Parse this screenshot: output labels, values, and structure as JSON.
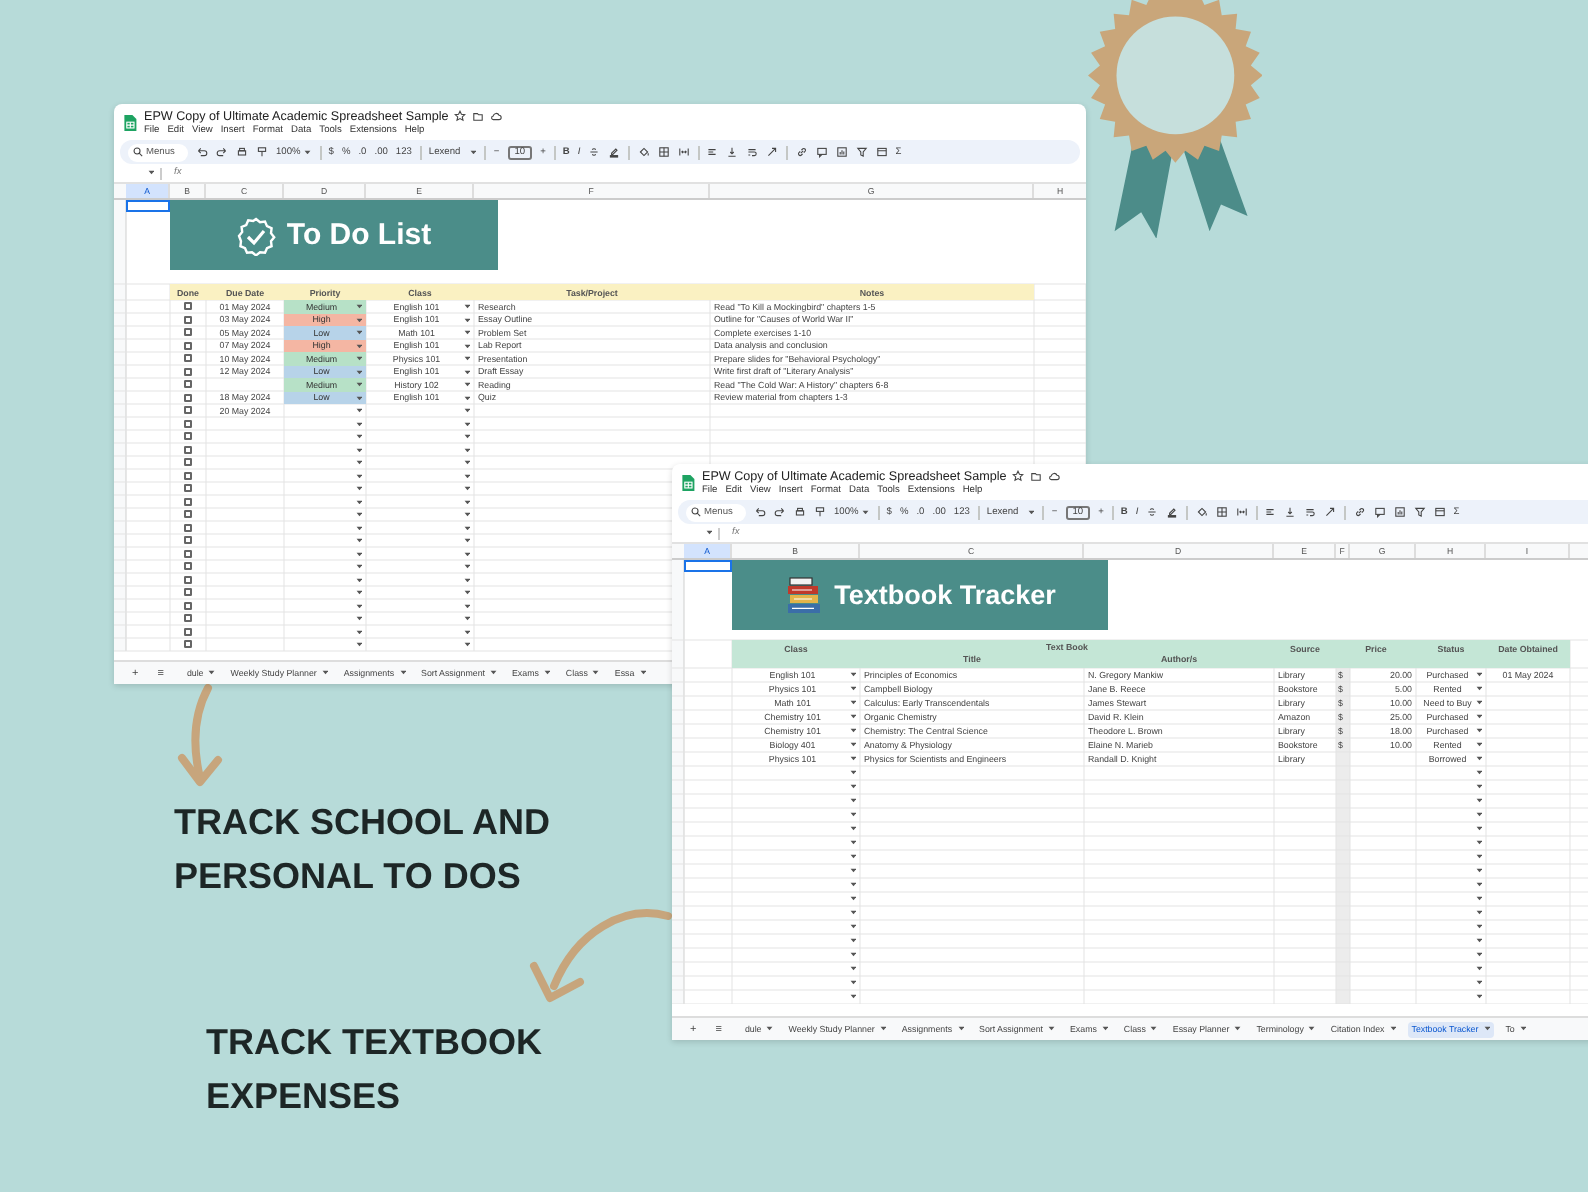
{
  "windows": [
    {
      "kind": "todo",
      "title": "EPW Copy of Ultimate Academic Spreadsheet Sample",
      "menu": [
        "File",
        "Edit",
        "View",
        "Insert",
        "Format",
        "Data",
        "Tools",
        "Extensions",
        "Help"
      ],
      "toolbar": {
        "search_placeholder": "Menus",
        "zoom": "100%",
        "currency": "$",
        "percent": "%",
        "decrease_decimal": ".0",
        "increase_decimal": ".00",
        "number_format": "123",
        "font": "Lexend",
        "decrease_size": "−",
        "font_size": "10",
        "increase_size": "+",
        "bold": "B",
        "italic": "I",
        "functions": "Σ"
      },
      "formula_label": "fx",
      "columns": [
        "A",
        "B",
        "C",
        "D",
        "E",
        "F",
        "G",
        "H"
      ],
      "banner": {
        "title": "To Do List"
      },
      "table": {
        "columns": [
          "Done",
          "Due Date",
          "Priority",
          "Class",
          "Task/Project",
          "Notes"
        ],
        "rows": [
          {
            "done": false,
            "due": "01 May 2024",
            "priority": {
              "label": "Medium",
              "color": "#b7e1c7"
            },
            "class": "English 101",
            "task": "Research",
            "notes": "Read \"To Kill a Mockingbird\" chapters 1-5"
          },
          {
            "done": false,
            "due": "03 May 2024",
            "priority": {
              "label": "High",
              "color": "#f4b6a3"
            },
            "class": "English 101",
            "task": "Essay Outline",
            "notes": "Outline for \"Causes of World War II\""
          },
          {
            "done": false,
            "due": "05 May 2024",
            "priority": {
              "label": "Low",
              "color": "#b7d3e9"
            },
            "class": "Math 101",
            "task": "Problem Set",
            "notes": "Complete exercises 1-10"
          },
          {
            "done": false,
            "due": "07 May 2024",
            "priority": {
              "label": "High",
              "color": "#f4b6a3"
            },
            "class": "English 101",
            "task": "Lab Report",
            "notes": "Data analysis and conclusion"
          },
          {
            "done": false,
            "due": "10 May 2024",
            "priority": {
              "label": "Medium",
              "color": "#b7e1c7"
            },
            "class": "Physics 101",
            "task": "Presentation",
            "notes": "Prepare slides for \"Behavioral Psychology\""
          },
          {
            "done": false,
            "due": "12 May 2024",
            "priority": {
              "label": "Low",
              "color": "#b7d3e9"
            },
            "class": "English 101",
            "task": "Draft Essay",
            "notes": "Write first draft of \"Literary Analysis\""
          },
          {
            "done": false,
            "priority": {
              "label": "Medium",
              "color": "#b7e1c7"
            },
            "class": "History 102",
            "task": "Reading",
            "notes": "Read \"The Cold War: A History\" chapters 6-8"
          },
          {
            "done": false,
            "due": "18 May 2024",
            "priority": {
              "label": "Low",
              "color": "#b7d3e9"
            },
            "class": "English 101",
            "task": "Quiz",
            "notes": "Review material from chapters 1-3"
          },
          {
            "done": false,
            "due": "20 May 2024"
          },
          {
            "done": false
          },
          {
            "done": false
          },
          {
            "done": false
          },
          {
            "done": false
          },
          {
            "done": false
          },
          {
            "done": false
          },
          {
            "done": false
          },
          {
            "done": false
          },
          {
            "done": false
          },
          {
            "done": false
          },
          {
            "done": false
          },
          {
            "done": false
          },
          {
            "done": false
          },
          {
            "done": false
          },
          {
            "done": false
          },
          {
            "done": false
          },
          {
            "done": false
          },
          {
            "done": false
          }
        ]
      },
      "sheet_bar": {
        "add": "+",
        "all_sheets": "≡",
        "tabs": [
          {
            "label": "dule",
            "selected": false
          },
          {
            "label": "Weekly Study Planner",
            "selected": false
          },
          {
            "label": "Assignments",
            "selected": false
          },
          {
            "label": "Sort Assignment",
            "selected": false
          },
          {
            "label": "Exams",
            "selected": false
          },
          {
            "label": "Class",
            "selected": false
          },
          {
            "label": "Essa",
            "selected": false
          }
        ]
      }
    },
    {
      "kind": "textbook",
      "title": "EPW Copy of Ultimate Academic Spreadsheet Sample",
      "menu": [
        "File",
        "Edit",
        "View",
        "Insert",
        "Format",
        "Data",
        "Tools",
        "Extensions",
        "Help"
      ],
      "toolbar": {
        "search_placeholder": "Menus",
        "zoom": "100%",
        "currency": "$",
        "percent": "%",
        "decrease_decimal": ".0",
        "increase_decimal": ".00",
        "number_format": "123",
        "font": "Lexend",
        "decrease_size": "−",
        "font_size": "10",
        "increase_size": "+",
        "bold": "B",
        "italic": "I",
        "functions": "Σ"
      },
      "formula_label": "fx",
      "columns": [
        "A",
        "B",
        "C",
        "D",
        "E",
        "F",
        "G",
        "H",
        "I"
      ],
      "banner": {
        "title": "Textbook Tracker"
      },
      "table": {
        "group_header": "Text Book",
        "columns": [
          "Class",
          "Title",
          "Author/s",
          "Source",
          "Price",
          "Status",
          "Date Obtained"
        ],
        "rows": [
          {
            "class": "English 101",
            "title": "Principles of Economics",
            "author": "N. Gregory Mankiw",
            "source": "Library",
            "currency": "$",
            "price": "20.00",
            "status": "Purchased",
            "date": "01 May 2024"
          },
          {
            "class": "Physics 101",
            "title": "Campbell Biology",
            "author": "Jane B. Reece",
            "source": "Bookstore",
            "currency": "$",
            "price": "5.00",
            "status": "Rented"
          },
          {
            "class": "Math 101",
            "title": "Calculus: Early Transcendentals",
            "author": "James Stewart",
            "source": "Library",
            "currency": "$",
            "price": "10.00",
            "status": "Need to Buy"
          },
          {
            "class": "Chemistry 101",
            "title": "Organic Chemistry",
            "author": "David R. Klein",
            "source": "Amazon",
            "currency": "$",
            "price": "25.00",
            "status": "Purchased"
          },
          {
            "class": "Chemistry 101",
            "title": "Chemistry: The Central Science",
            "author": "Theodore L. Brown",
            "source": "Library",
            "currency": "$",
            "price": "18.00",
            "status": "Purchased"
          },
          {
            "class": "Biology 401",
            "title": "Anatomy & Physiology",
            "author": "Elaine N. Marieb",
            "source": "Bookstore",
            "currency": "$",
            "price": "10.00",
            "status": "Rented"
          },
          {
            "class": "Physics 101",
            "title": "Physics for Scientists and Engineers",
            "author": "Randall D. Knight",
            "source": "Library",
            "status": "Borrowed"
          }
        ]
      },
      "sheet_bar": {
        "add": "+",
        "all_sheets": "≡",
        "tabs": [
          {
            "label": "dule",
            "selected": false
          },
          {
            "label": "Weekly Study Planner",
            "selected": false
          },
          {
            "label": "Assignments",
            "selected": false
          },
          {
            "label": "Sort Assignment",
            "selected": false
          },
          {
            "label": "Exams",
            "selected": false
          },
          {
            "label": "Class",
            "selected": false
          },
          {
            "label": "Essay Planner",
            "selected": false
          },
          {
            "label": "Terminology",
            "selected": false
          },
          {
            "label": "Citation Index",
            "selected": false
          },
          {
            "label": "Textbook Tracker",
            "selected": true
          },
          {
            "label": "To",
            "selected": false
          }
        ]
      }
    }
  ],
  "captions": [
    "TRACK SCHOOL AND PERSONAL TO DOS",
    "TRACK TEXTBOOK EXPENSES"
  ]
}
